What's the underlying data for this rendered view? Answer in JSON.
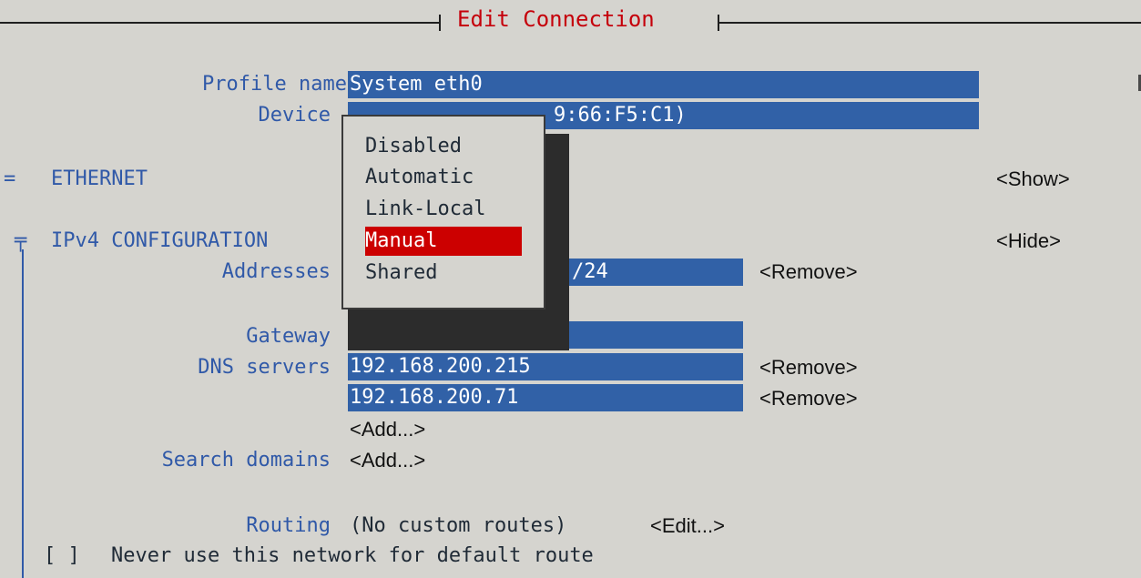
{
  "window": {
    "title": "Edit Connection"
  },
  "profile": {
    "label": "Profile name",
    "value": "System eth0"
  },
  "device": {
    "label": "Device",
    "value_visible": "9:66:F5:C1)"
  },
  "ethernet": {
    "label": "ETHERNET",
    "marker": "=",
    "toggle": "<Show>"
  },
  "ipv4": {
    "label": "IPv4 CONFIGURATION",
    "marker": "╤",
    "toggle": "<Hide>",
    "addresses": {
      "label": "Addresses",
      "value_visible": "/24",
      "remove": "<Remove>"
    },
    "gateway": {
      "label": "Gateway",
      "value": ""
    },
    "dns": {
      "label": "DNS servers",
      "servers": [
        {
          "value": "192.168.200.215",
          "remove": "<Remove>"
        },
        {
          "value": "192.168.200.71",
          "remove": "<Remove>"
        }
      ],
      "add": "<Add...>"
    },
    "search_domains": {
      "label": "Search domains",
      "add": "<Add...>"
    },
    "routing": {
      "label": "Routing",
      "value": "(No custom routes)",
      "edit": "<Edit...>"
    },
    "never_default": {
      "checkbox": "[ ]",
      "label": "Never use this network for default route"
    }
  },
  "method_popup": {
    "options": [
      "Disabled",
      "Automatic",
      "Link-Local",
      "Manual",
      "Shared"
    ],
    "selected": "Manual"
  },
  "colors": {
    "background": "#d5d4cf",
    "field": "#3161a7",
    "label": "#3059a8",
    "title": "#c5000b",
    "selected": "#cc0000"
  }
}
